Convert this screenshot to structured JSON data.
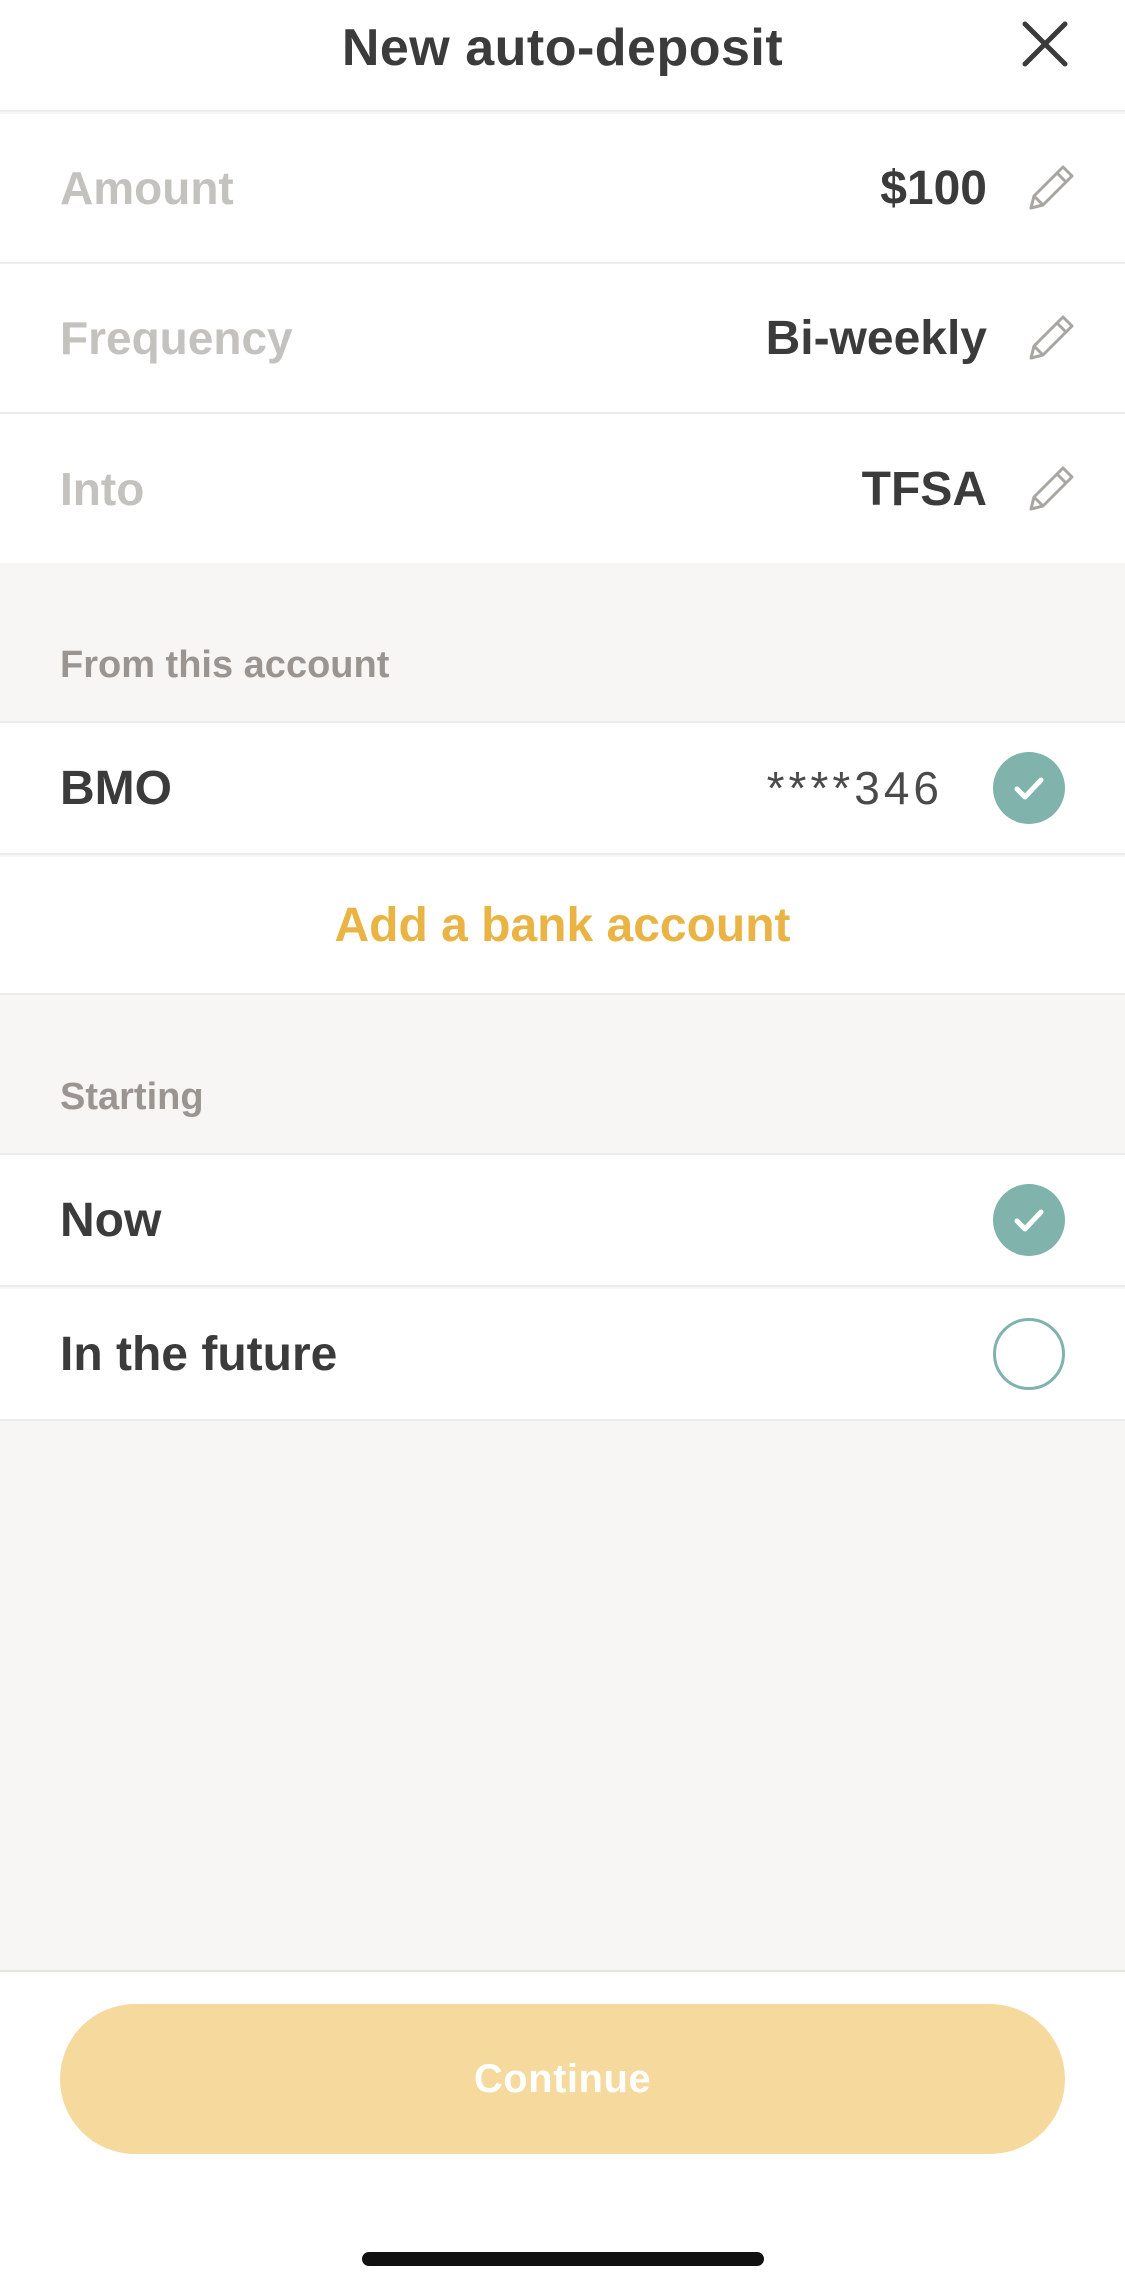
{
  "header": {
    "title": "New auto-deposit",
    "close_icon": "close-icon"
  },
  "settings": [
    {
      "label": "Amount",
      "value": "$100"
    },
    {
      "label": "Frequency",
      "value": "Bi-weekly"
    },
    {
      "label": "Into",
      "value": "TFSA"
    }
  ],
  "from_account": {
    "section_title": "From this account",
    "accounts": [
      {
        "name": "BMO",
        "masked_number": "****346",
        "selected": true
      }
    ],
    "add_account_label": "Add a bank account"
  },
  "starting": {
    "section_title": "Starting",
    "options": [
      {
        "label": "Now",
        "selected": true
      },
      {
        "label": "In the future",
        "selected": false
      }
    ]
  },
  "footer": {
    "continue_label": "Continue",
    "disabled": true
  },
  "colors": {
    "accent_teal": "#7fb3ab",
    "link_gold": "#e9b444",
    "button_disabled": "#f6d99c",
    "text_dark": "#3b3b3b",
    "label_muted": "#c4c2bf",
    "background": "#f7f6f4"
  }
}
